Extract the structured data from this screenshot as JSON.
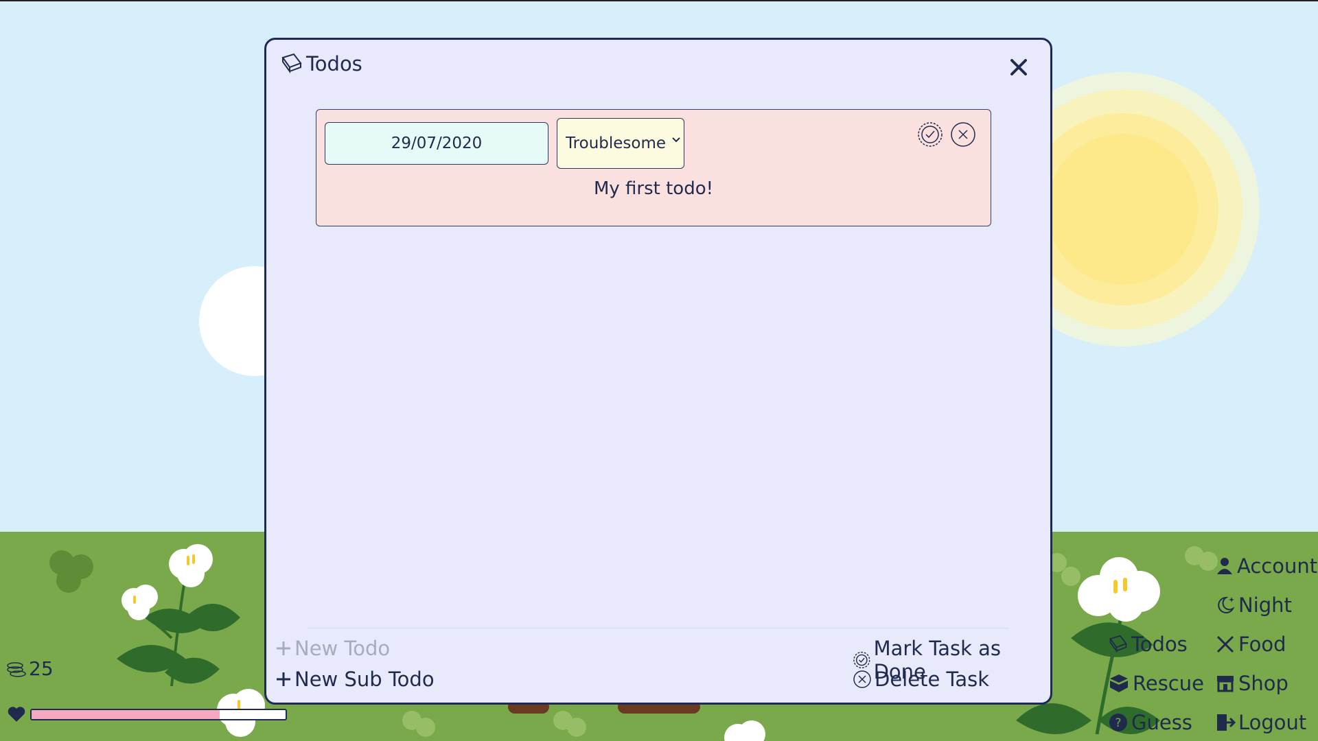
{
  "window": {
    "title": "Todos"
  },
  "todo": {
    "date": "29/07/2020",
    "difficulty": "Troublesome",
    "text": "My first todo!"
  },
  "footer": {
    "new_todo": "New Todo",
    "new_sub_todo": "New Sub Todo",
    "mark_done": "Mark Task as Done",
    "delete_task": "Delete Task"
  },
  "nav": {
    "account": "Account",
    "night": "Night",
    "todos": "Todos",
    "food": "Food",
    "rescue": "Rescue",
    "shop": "Shop",
    "guess": "Guess",
    "logout": "Logout"
  },
  "status": {
    "coins": "25",
    "health_fraction": 0.74
  },
  "colors": {
    "sky": "#d7eefb",
    "grass": "#79a94a",
    "modal_bg": "#e8e9fb",
    "card_bg": "#fae0df",
    "accent": "#1e2a55"
  }
}
